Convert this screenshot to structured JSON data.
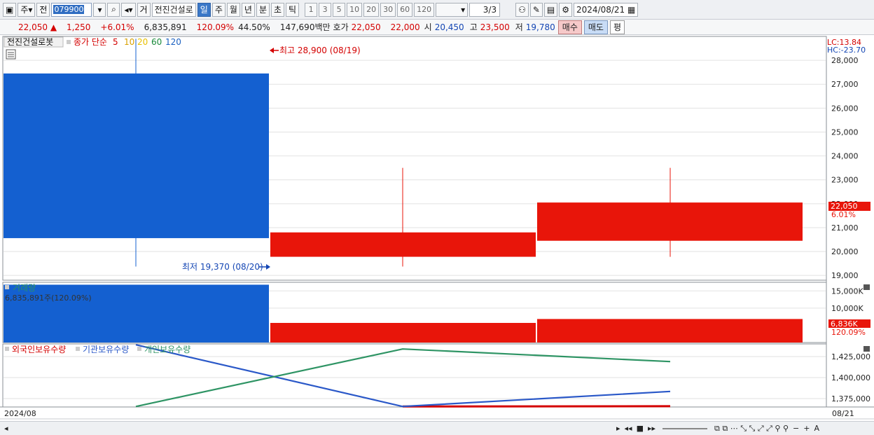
{
  "toolbar": {
    "stock_type": "주",
    "prefix": "전",
    "code": "079900",
    "trade_label": "거",
    "name": "전진건설로",
    "periods": [
      "일",
      "주",
      "월",
      "년",
      "분",
      "초",
      "틱"
    ],
    "selected_period": "일",
    "intervals": [
      "1",
      "3",
      "5",
      "10",
      "20",
      "30",
      "60",
      "120"
    ],
    "page": "3/3",
    "date": "2024/08/21"
  },
  "quote": {
    "price": "22,050",
    "change": "1,250",
    "change_pct": "+6.01%",
    "volume": "6,835,891",
    "vol_ratio": "120.09%",
    "turnover": "44.50%",
    "amount": "147,690백만",
    "hoga_label": "호가",
    "ask": "22,050",
    "bid": "22,000",
    "open_label": "시",
    "open": "20,450",
    "high_label": "고",
    "high": "23,500",
    "low_label": "저",
    "low": "19,780",
    "buy_label": "매수",
    "sell_label": "매도",
    "avg_label": "평"
  },
  "colors": {
    "up": "#e8150a",
    "down": "#1460d0",
    "inst": "#2a58c8",
    "indiv": "#2e9464",
    "foreign": "#d40000"
  },
  "legend": {
    "stock_name": "전진건설로봇",
    "ma_label": "종가 단순",
    "ma_periods": [
      "5",
      "10",
      "20",
      "60",
      "120"
    ],
    "ma_colors": [
      "#d40000",
      "#d8a000",
      "#e8c000",
      "#1a8a3a",
      "#1a60c0"
    ]
  },
  "lc_label": "LC:13.84",
  "hc_label": "HC:-23.70",
  "high_annotation": "최고 28,900 (08/19)",
  "low_annotation": "최저 19,370 (08/20)",
  "price_tag": "22,050",
  "price_tag_pct": "6.01%",
  "volume_panel": {
    "title": "거래량",
    "readout": "6,835,891주(120.09%)",
    "tag": "6,836K",
    "tag_pct": "120.09%"
  },
  "holdings_panel": {
    "series_names": [
      "외국인보유수량",
      "기관보유수량",
      "개인보유수량"
    ]
  },
  "x_label_left": "2024/08",
  "x_label_right": "08/21",
  "chart_data": [
    {
      "type": "candlestick",
      "categories": [
        "08/19",
        "08/20",
        "08/21"
      ],
      "open": [
        27450,
        19780,
        20450
      ],
      "high": [
        28900,
        23500,
        23500
      ],
      "low": [
        19370,
        19370,
        19780
      ],
      "close": [
        20560,
        20800,
        22050
      ],
      "direction": [
        "down",
        "up",
        "up"
      ],
      "ylim": [
        18800,
        29000
      ],
      "yticks": [
        "19,000",
        "20,000",
        "21,000",
        "22,000",
        "23,000",
        "24,000",
        "25,000",
        "26,000",
        "27,000",
        "28,000"
      ],
      "ytick_values": [
        19000,
        20000,
        21000,
        22000,
        23000,
        24000,
        25000,
        26000,
        27000,
        28000
      ]
    },
    {
      "type": "bar",
      "title": "거래량",
      "categories": [
        "08/19",
        "08/20",
        "08/21"
      ],
      "values": [
        16800,
        5700,
        6836
      ],
      "unit": "K",
      "ylim": [
        0,
        17500
      ],
      "yticks": [
        "10,000K",
        "15,000K"
      ],
      "ytick_values": [
        10000,
        15000
      ]
    },
    {
      "type": "line",
      "categories": [
        "08/19",
        "08/20",
        "08/21"
      ],
      "series": [
        {
          "name": "외국인보유수량",
          "values": [
            null,
            1365600,
            1365900
          ]
        },
        {
          "name": "기관보유수량",
          "values": [
            1439000,
            1365600,
            1383500
          ]
        },
        {
          "name": "개인보유수량",
          "values": [
            1365600,
            1434000,
            1419000
          ]
        }
      ],
      "ylim": [
        1365000,
        1440000
      ],
      "yticks": [
        "1,375,000",
        "1,400,000",
        "1,425,000"
      ],
      "ytick_values": [
        1375000,
        1400000,
        1425000
      ]
    }
  ]
}
